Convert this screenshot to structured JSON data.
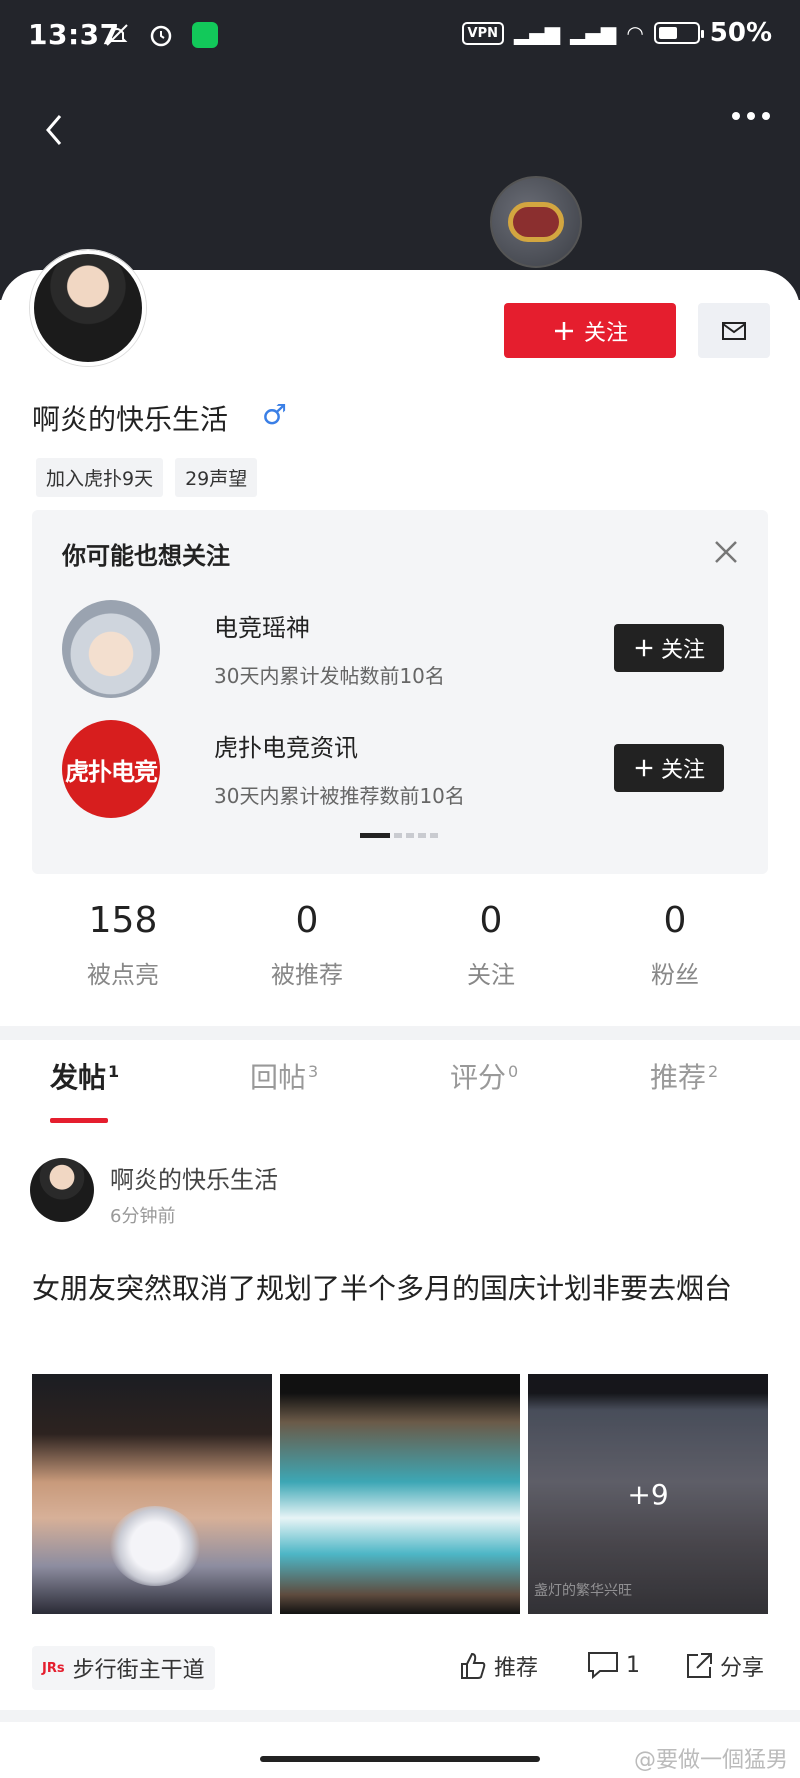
{
  "status_bar": {
    "time": "13:37",
    "vpn": "VPN",
    "battery": "50%"
  },
  "profile": {
    "follow_label": "关注",
    "username": "啊炎的快乐生活",
    "gender_symbol": "♂",
    "tags": [
      "加入虎扑9天",
      "29声望"
    ]
  },
  "suggest": {
    "title": "你可能也想关注",
    "items": [
      {
        "name": "电竞瑶神",
        "desc": "30天内累计发帖数前10名",
        "follow_label": "关注"
      },
      {
        "name": "虎扑电竞资讯",
        "desc": "30天内累计被推荐数前10名",
        "follow_label": "关注",
        "avatar_text": "虎扑电竞"
      }
    ]
  },
  "stats": [
    {
      "value": "158",
      "label": "被点亮"
    },
    {
      "value": "0",
      "label": "被推荐"
    },
    {
      "value": "0",
      "label": "关注"
    },
    {
      "value": "0",
      "label": "粉丝"
    }
  ],
  "tabs": [
    {
      "label": "发帖",
      "count": "1"
    },
    {
      "label": "回帖",
      "count": "3"
    },
    {
      "label": "评分",
      "count": "0"
    },
    {
      "label": "推荐",
      "count": "2"
    }
  ],
  "post": {
    "author": "啊炎的快乐生活",
    "time": "6分钟前",
    "title": "女朋友突然取消了规划了半个多月的国庆计划非要去烟台",
    "more_images": "+9",
    "image_caption": "盏灯的繁华兴旺",
    "source_logo": "JRs",
    "source": "步行街主干道",
    "recommend_label": "推荐",
    "comment_count": "1",
    "share_label": "分享"
  },
  "watermark": "@要做一個猛男",
  "colors": {
    "accent": "#e51e2e",
    "header_bg": "#23252b",
    "gender": "#3a7fe6"
  }
}
